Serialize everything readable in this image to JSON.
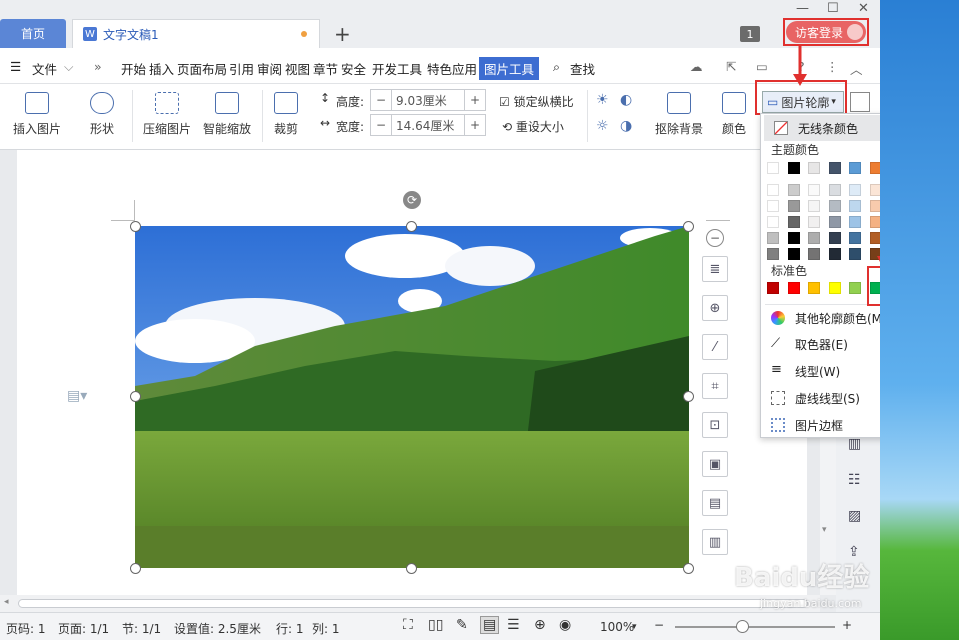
{
  "titlebar": {
    "home_tab": "首页",
    "doc_tab": "文字文稿1",
    "doc_icon": "W",
    "badge": "1",
    "login": "访客登录"
  },
  "menubar": {
    "file": "文件",
    "items": [
      "开始",
      "插入",
      "页面布局",
      "引用",
      "审阅",
      "视图",
      "章节",
      "安全",
      "开发工具",
      "特色应用"
    ],
    "active": "图片工具",
    "search": "查找"
  },
  "ribbon": {
    "insert_pic": "插入图片",
    "shape": "形状",
    "compress": "压缩图片",
    "smart_zoom": "智能缩放",
    "crop": "裁剪",
    "height_label": "高度:",
    "height_value": "9.03厘米",
    "width_label": "宽度:",
    "width_value": "14.64厘米",
    "lock_ratio": "锁定纵横比",
    "resize": "重设大小",
    "remove_bg": "抠除背景",
    "color": "颜色",
    "pic_outline": "图片轮廓"
  },
  "dropdown": {
    "no_line": "无线条颜色",
    "theme_header": "主题颜色",
    "standard_header": "标准色",
    "more_colors": "其他轮廓颜色(M)...",
    "eyedropper": "取色器(E)",
    "line_type": "线型(W)",
    "dash_type": "虚线线型(S)",
    "pic_border": "图片边框",
    "theme_top": [
      "#ffffff",
      "#000000",
      "#e7e6e6",
      "#44546a",
      "#5b9bd5",
      "#ed7d31",
      "#a5a5a5",
      "#ffc000",
      "#4472c4",
      "#70ad47"
    ],
    "standard": [
      "#c00000",
      "#ff0000",
      "#ffc000",
      "#ffff00",
      "#92d050",
      "#00b050",
      "#00b0f0",
      "#0070c0",
      "#002060",
      "#7030a0"
    ]
  },
  "status": {
    "page_num": "页码: 1",
    "pages": "页面: 1/1",
    "section": "节: 1/1",
    "setting": "设置值: 2.5厘米",
    "row": "行: 1",
    "col": "列: 1",
    "zoom": "100%"
  },
  "watermark": {
    "brand": "Baidu经验",
    "url": "jingyan.baidu.com"
  }
}
